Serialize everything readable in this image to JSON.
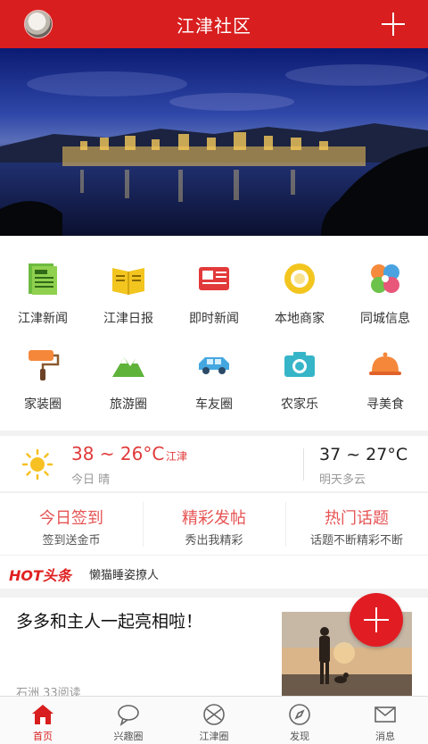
{
  "header": {
    "title": "江津社区"
  },
  "grid": {
    "row1": [
      {
        "label": "江津新闻",
        "icon": "news-icon"
      },
      {
        "label": "江津日报",
        "icon": "newspaper-icon"
      },
      {
        "label": "即时新闻",
        "icon": "instant-news-icon"
      },
      {
        "label": "本地商家",
        "icon": "merchant-icon"
      },
      {
        "label": "同城信息",
        "icon": "city-info-icon"
      }
    ],
    "row2": [
      {
        "label": "家装圈",
        "icon": "paint-roller-icon"
      },
      {
        "label": "旅游圈",
        "icon": "mountain-icon"
      },
      {
        "label": "车友圈",
        "icon": "car-icon"
      },
      {
        "label": "农家乐",
        "icon": "camera-icon"
      },
      {
        "label": "寻美食",
        "icon": "food-cloche-icon"
      }
    ]
  },
  "weather": {
    "today_temp": "38 ~ 26°C",
    "city": "江津",
    "today_label": "今日 晴",
    "tomorrow_temp": "37 ~ 27°C",
    "tomorrow_label": "明天多云"
  },
  "actions": [
    {
      "title": "今日签到",
      "sub": "签到送金币"
    },
    {
      "title": "精彩发帖",
      "sub": "秀出我精彩"
    },
    {
      "title": "热门话题",
      "sub": "话题不断精彩不断"
    }
  ],
  "hot": {
    "logo": "HOT头条",
    "text": "懒猫睡姿撩人"
  },
  "feed": {
    "title": "多多和主人一起亮相啦！",
    "meta": "石洲 33阅读"
  },
  "tabs": [
    {
      "label": "首页",
      "icon": "home-icon"
    },
    {
      "label": "兴趣圈",
      "icon": "chat-bubble-icon"
    },
    {
      "label": "江津圈",
      "icon": "circle-logo-icon"
    },
    {
      "label": "发现",
      "icon": "compass-icon"
    },
    {
      "label": "消息",
      "icon": "mail-icon"
    }
  ],
  "colors": {
    "brand": "#d81e1e",
    "accent_text": "#e65454"
  }
}
